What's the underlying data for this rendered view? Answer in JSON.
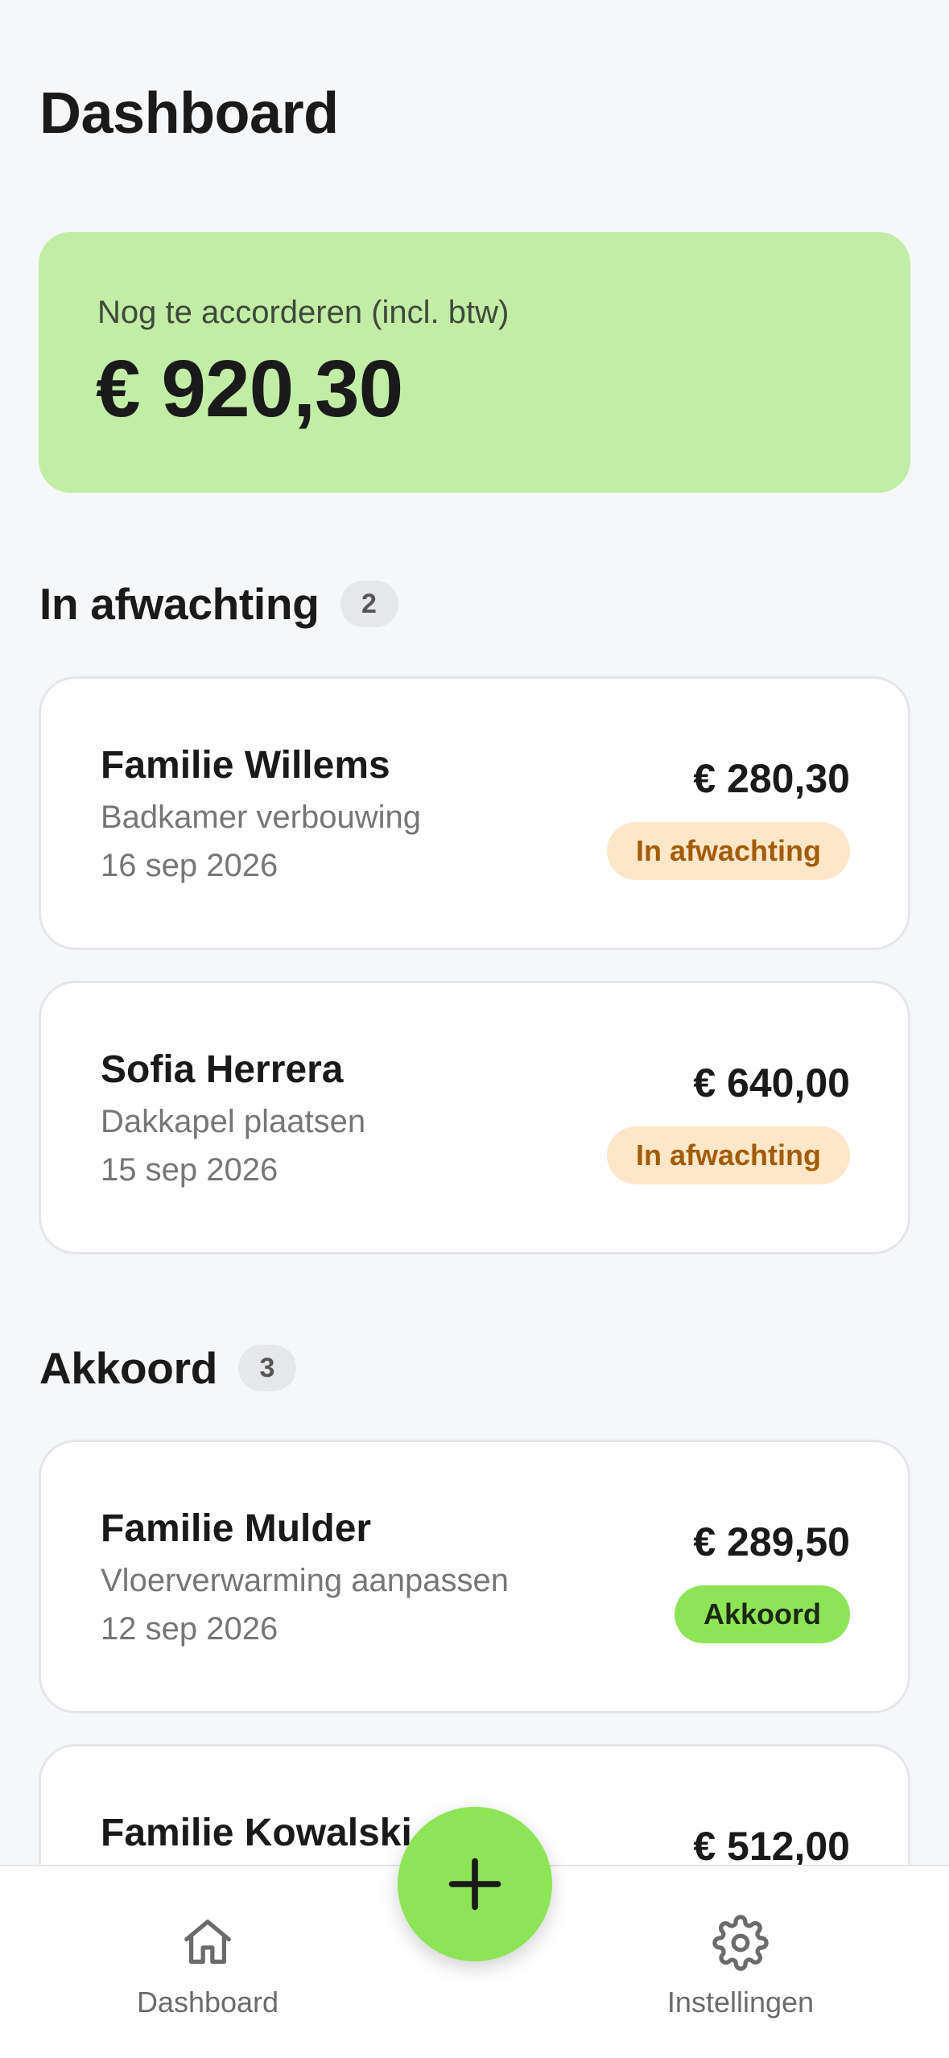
{
  "header": {
    "title": "Dashboard"
  },
  "summary": {
    "label": "Nog te accorderen (incl. btw)",
    "amount": "€ 920,30"
  },
  "sections": [
    {
      "title": "In afwachting",
      "count": "2",
      "items": [
        {
          "name": "Familie Willems",
          "description": "Badkamer verbouwing",
          "date": "16 sep 2026",
          "amount": "€ 280,30",
          "status": "In afwachting"
        },
        {
          "name": "Sofia Herrera",
          "description": "Dakkapel plaatsen",
          "date": "15 sep 2026",
          "amount": "€ 640,00",
          "status": "In afwachting"
        }
      ]
    },
    {
      "title": "Akkoord",
      "count": "3",
      "items": [
        {
          "name": "Familie Mulder",
          "description": "Vloerverwarming aanpassen",
          "date": "12 sep 2026",
          "amount": "€ 289,50",
          "status": "Akkoord"
        },
        {
          "name": "Familie Kowalski",
          "amount": "€ 512,00"
        }
      ]
    }
  ],
  "bottom_nav": {
    "items": [
      {
        "label": "Dashboard",
        "icon": "home-icon"
      },
      {
        "label": "Instellingen",
        "icon": "gear-icon"
      }
    ],
    "fab_icon": "plus-icon"
  },
  "colors": {
    "accent": "#8ee457",
    "summary_bg": "#c2eda6",
    "pending_bg": "#fde7c8",
    "pending_text": "#a35c0a",
    "background": "#f6f7f9"
  }
}
